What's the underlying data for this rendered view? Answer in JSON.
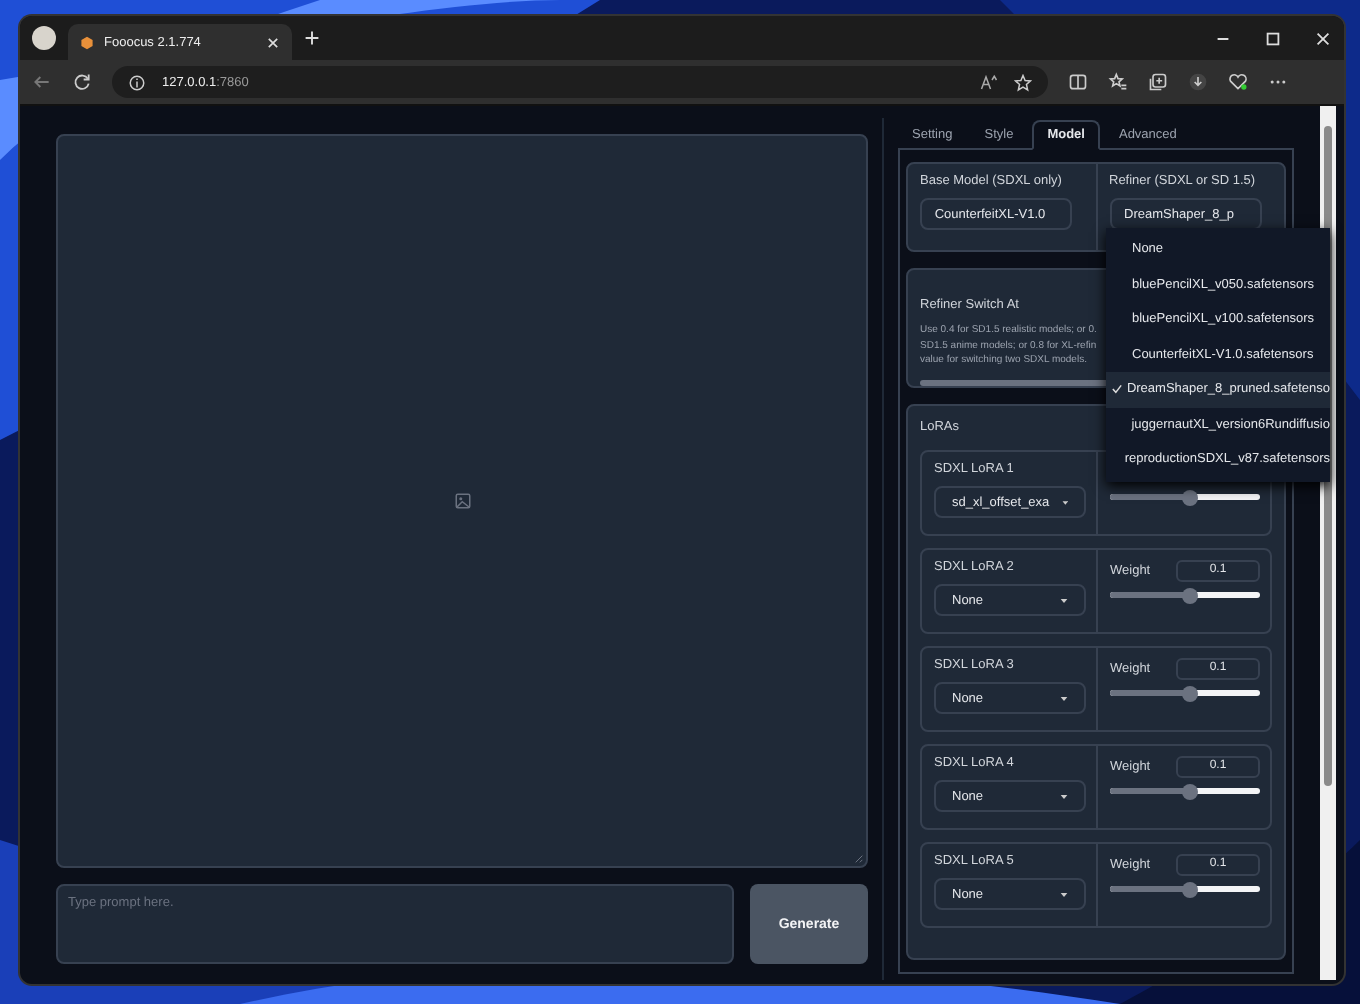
{
  "browser": {
    "tab_title": "Fooocus 2.1.774",
    "url_host": "127.0.0.1",
    "url_port": ":7860"
  },
  "prompt": {
    "placeholder": "Type prompt here."
  },
  "generate_button": "Generate",
  "tabs": [
    {
      "label": "Setting",
      "selected": false
    },
    {
      "label": "Style",
      "selected": false
    },
    {
      "label": "Model",
      "selected": true
    },
    {
      "label": "Advanced",
      "selected": false
    }
  ],
  "base_model": {
    "label": "Base Model (SDXL only)",
    "value": "CounterfeitXL-V1.0"
  },
  "refiner": {
    "label": "Refiner (SDXL or SD 1.5)",
    "value": "DreamShaper_8_p",
    "options": [
      {
        "label": "None",
        "selected": false
      },
      {
        "label": "bluePencilXL_v050.safetensors",
        "selected": false
      },
      {
        "label": "bluePencilXL_v100.safetensors",
        "selected": false
      },
      {
        "label": "CounterfeitXL-V1.0.safetensors",
        "selected": false
      },
      {
        "label": "DreamShaper_8_pruned.safetenso",
        "selected": true
      },
      {
        "label": "juggernautXL_version6Rundiffusio",
        "selected": false
      },
      {
        "label": "reproductionSDXL_v87.safetensors",
        "selected": false
      }
    ]
  },
  "refiner_switch": {
    "label": "Refiner Switch At",
    "description_lines": [
      "Use 0.4 for SD1.5 realistic models; or 0.",
      "SD1.5 anime models; or 0.8 for XL-refin",
      "value for switching two SDXL models."
    ]
  },
  "loras": {
    "title": "LoRAs",
    "items": [
      {
        "label": "SDXL LoRA 1",
        "value": "sd_xl_offset_exa",
        "level": 0.53
      },
      {
        "label": "SDXL LoRA 2",
        "value": "None",
        "weight_label": "Weight",
        "weight": "0.1",
        "level": 0.53
      },
      {
        "label": "SDXL LoRA 3",
        "value": "None",
        "weight_label": "Weight",
        "weight": "0.1",
        "level": 0.53
      },
      {
        "label": "SDXL LoRA 4",
        "value": "None",
        "weight_label": "Weight",
        "weight": "0.1",
        "level": 0.53
      },
      {
        "label": "SDXL LoRA 5",
        "value": "None",
        "weight_label": "Weight",
        "weight": "0.1",
        "level": 0.53
      }
    ]
  }
}
